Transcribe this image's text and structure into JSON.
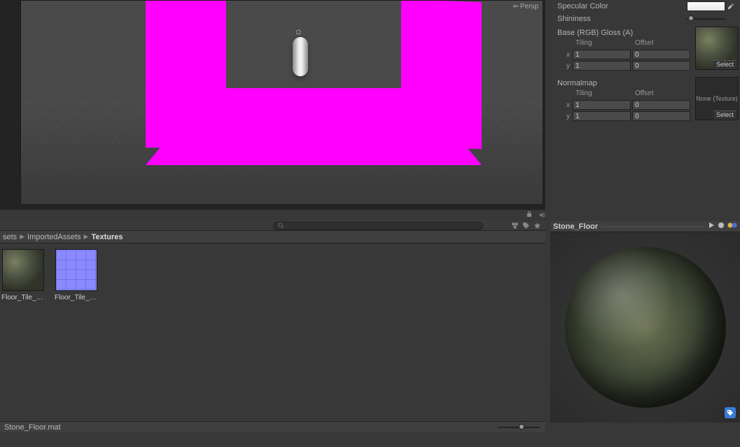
{
  "scene": {
    "camera_label": "Persp"
  },
  "inspector": {
    "specular_label": "Specular Color",
    "shininess_label": "Shininess",
    "shininess_value": 0.05,
    "base": {
      "label": "Base (RGB) Gloss (A)",
      "tiling_label": "Tiling",
      "offset_label": "Offset",
      "x_label": "x",
      "y_label": "y",
      "tiling_x": "1",
      "tiling_y": "1",
      "offset_x": "0",
      "offset_y": "0",
      "select_label": "Select"
    },
    "normal": {
      "label": "Normalmap",
      "tiling_label": "Tiling",
      "offset_label": "Offset",
      "x_label": "x",
      "y_label": "y",
      "tiling_x": "1",
      "tiling_y": "1",
      "offset_x": "0",
      "offset_y": "0",
      "thumb_text": "None (Texture)",
      "select_label": "Select"
    }
  },
  "project": {
    "breadcrumb": {
      "seg0": "sets",
      "seg1": "ImportedAssets",
      "seg2": "Textures"
    },
    "assets": {
      "a0": "Floor_Tile_Di...",
      "a1": "Floor_Tile_N..."
    },
    "status": "Stone_Floor.mat"
  },
  "preview": {
    "title": "Stone_Floor"
  }
}
